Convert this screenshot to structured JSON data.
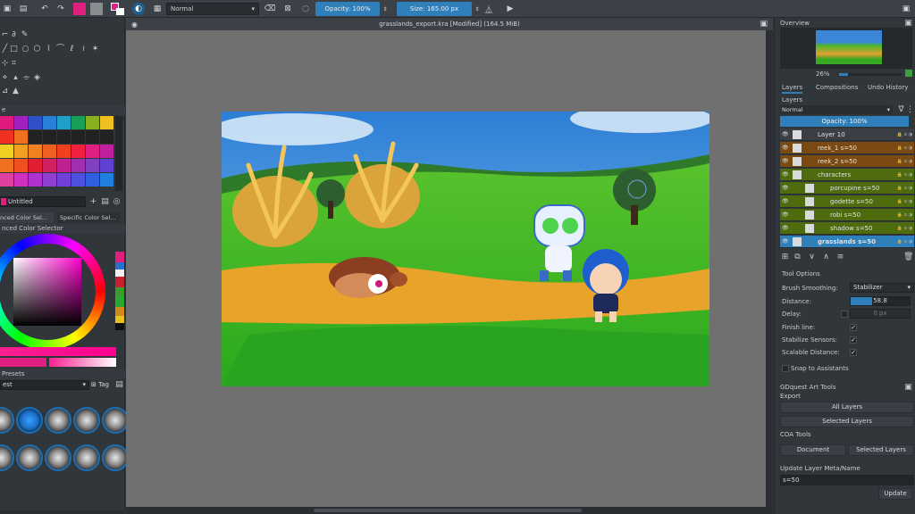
{
  "toolbar": {
    "blend_mode": "Normal",
    "opacity_label": "Opacity:",
    "opacity_value": "100%",
    "size_label": "Size:",
    "size_value": "165.00 px"
  },
  "document": {
    "title": "grasslands_export.kra [Modified]  (164.5 MiB)"
  },
  "left_panel": {
    "palette_name": "Untitled",
    "tab_advanced": "nced Color Sel...",
    "tab_specific": "Specific Color Sel...",
    "advanced_header": "nced Color Selector",
    "presets_header": "Presets",
    "presets_filter": "est",
    "presets_tag": "Tag"
  },
  "overview": {
    "header": "Overview",
    "zoom": "26%"
  },
  "layers_panel": {
    "tabs": [
      "Layers",
      "Compositions",
      "Undo History"
    ],
    "header": "Layers",
    "blend": "Normal",
    "opacity": "Opacity:  100%",
    "layers": [
      {
        "name": "Layer 10",
        "color": "#3a3f45",
        "indent": 0
      },
      {
        "name": "reek_1 s=50",
        "color": "#7a4a12",
        "indent": 0
      },
      {
        "name": "reek_2 s=50",
        "color": "#7a4a12",
        "indent": 0
      },
      {
        "name": "characters",
        "color": "#4e6b0e",
        "indent": 0
      },
      {
        "name": "porcupine s=50",
        "color": "#4e6b0e",
        "indent": 1
      },
      {
        "name": "godette s=50",
        "color": "#4e6b0e",
        "indent": 1
      },
      {
        "name": "robi s=50",
        "color": "#4e6b0e",
        "indent": 1
      },
      {
        "name": "shadow s=50",
        "color": "#4e6b0e",
        "indent": 1
      },
      {
        "name": "grasslands s=50",
        "color": "#2f7fba",
        "indent": 0
      }
    ]
  },
  "tool_options": {
    "header": "Tool Options",
    "brush_smoothing_label": "Brush Smoothing:",
    "brush_smoothing_value": "Stabilizer",
    "distance_label": "Distance:",
    "distance_value": "58.8",
    "delay_label": "Delay:",
    "delay_value": "0 px",
    "finish_line_label": "Finish line:",
    "stabilize_sensors_label": "Stabilize Sensors:",
    "scalable_distance_label": "Scalable Distance:",
    "snap_label": "Snap to Assistants"
  },
  "gdquest": {
    "header": "GDquest Art Tools",
    "export_label": "Export",
    "all_layers": "All Layers",
    "selected_layers": "Selected Layers",
    "coa_label": "COA Tools",
    "document_btn": "Document",
    "selected_layers_btn": "Selected Layers",
    "update_meta_label": "Update Layer Meta/Name",
    "meta_value": "s=50",
    "update_btn": "Update"
  },
  "colors": {
    "accent": "#2f7fba",
    "panel": "#31363b"
  }
}
